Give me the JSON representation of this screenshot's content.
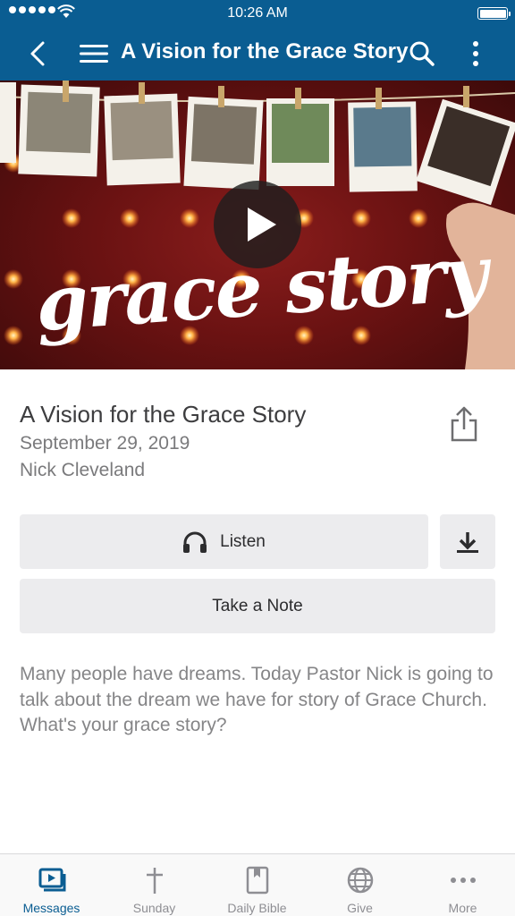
{
  "status_bar": {
    "time": "10:26 AM"
  },
  "nav": {
    "title": "A Vision for the Grace Story"
  },
  "hero": {
    "artwork_text": "grace story"
  },
  "message": {
    "title": "A Vision for the Grace Story",
    "date": "September 29, 2019",
    "speaker": "Nick Cleveland",
    "description": "Many people have dreams. Today Pastor Nick is going to talk about the dream we have for story of Grace Church. What's your grace story?"
  },
  "actions": {
    "listen_label": "Listen",
    "note_label": "Take a Note"
  },
  "tabs": [
    {
      "label": "Messages",
      "icon": "video-icon",
      "active": true
    },
    {
      "label": "Sunday",
      "icon": "cross-icon",
      "active": false
    },
    {
      "label": "Daily Bible",
      "icon": "bible-icon",
      "active": false
    },
    {
      "label": "Give",
      "icon": "globe-icon",
      "active": false
    },
    {
      "label": "More",
      "icon": "ellipsis-icon",
      "active": false
    }
  ],
  "colors": {
    "brand": "#0a5d92",
    "button_bg": "#ececee",
    "tab_inactive": "#8e8e93"
  }
}
